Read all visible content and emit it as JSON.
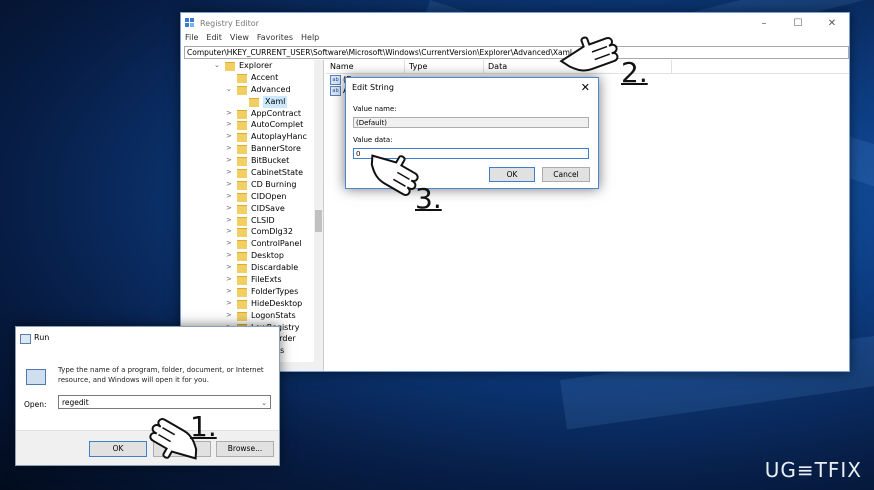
{
  "registry_editor": {
    "title": "Registry Editor",
    "window_controls": [
      "–",
      "☐",
      "✕"
    ],
    "menu": [
      "File",
      "Edit",
      "View",
      "Favorites",
      "Help"
    ],
    "address": "Computer\\HKEY_CURRENT_USER\\Software\\Microsoft\\Windows\\CurrentVersion\\Explorer\\Advanced\\Xaml",
    "tree": [
      {
        "label": "Explorer",
        "arrow": "⌄"
      },
      {
        "label": "Accent",
        "arrow": ""
      },
      {
        "label": "Advanced",
        "arrow": "⌄"
      },
      {
        "label": "Xaml",
        "arrow": "",
        "selected": true
      },
      {
        "label": "AppContract",
        "arrow": ">"
      },
      {
        "label": "AutoComplet",
        "arrow": ">"
      },
      {
        "label": "AutoplayHanc",
        "arrow": ">"
      },
      {
        "label": "BannerStore",
        "arrow": ">"
      },
      {
        "label": "BitBucket",
        "arrow": ">"
      },
      {
        "label": "CabinetState",
        "arrow": ">"
      },
      {
        "label": "CD Burning",
        "arrow": ">"
      },
      {
        "label": "CIDOpen",
        "arrow": ">"
      },
      {
        "label": "CIDSave",
        "arrow": ">"
      },
      {
        "label": "CLSID",
        "arrow": ">"
      },
      {
        "label": "ComDlg32",
        "arrow": ">"
      },
      {
        "label": "ControlPanel",
        "arrow": ">"
      },
      {
        "label": "Desktop",
        "arrow": ">"
      },
      {
        "label": "Discardable",
        "arrow": ">"
      },
      {
        "label": "FileExts",
        "arrow": ">"
      },
      {
        "label": "FolderTypes",
        "arrow": ">"
      },
      {
        "label": "HideDesktop",
        "arrow": ">"
      },
      {
        "label": "LogonStats",
        "arrow": ">"
      },
      {
        "label": "LowRegistry",
        "arrow": ">"
      },
      {
        "label": "MenuOrder",
        "arrow": ">"
      },
      {
        "label": "Modules",
        "arrow": ">"
      }
    ],
    "columns": [
      "Name",
      "Type",
      "Data"
    ],
    "values": [
      {
        "icon": "ab",
        "name": "(D"
      },
      {
        "icon": "ab",
        "name": "A"
      }
    ]
  },
  "edit_string": {
    "title": "Edit String",
    "close": "✕",
    "value_name_label": "Value name:",
    "value_name": "(Default)",
    "value_data_label": "Value data:",
    "value_data": "0",
    "ok": "OK",
    "cancel": "Cancel"
  },
  "run_dialog": {
    "title": "Run",
    "description": "Type the name of a program, folder, document, or Internet resource, and Windows will open it for you.",
    "open_label": "Open:",
    "open_value": "regedit",
    "ok": "OK",
    "cancel": "Cancel",
    "browse": "Browse..."
  },
  "steps": [
    "1.",
    "2.",
    "3."
  ],
  "watermark": "UG≡TFIX"
}
